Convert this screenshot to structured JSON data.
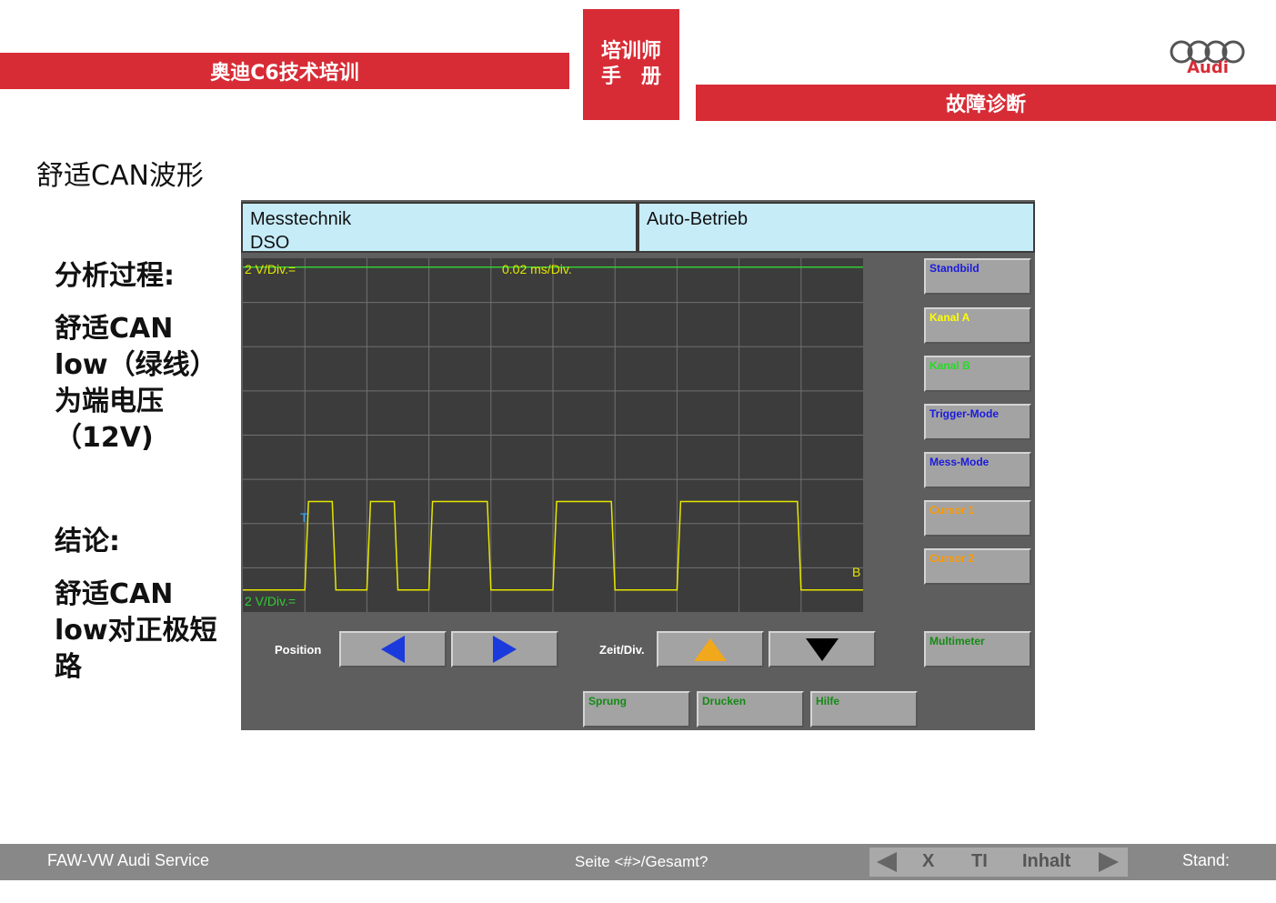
{
  "header": {
    "left_title": "奥迪C6技术培训",
    "center_line1": "培训师",
    "center_line2": "手　册",
    "right_title": "故障诊断",
    "logo_text": "Audi"
  },
  "slide_title": "舒适CAN波形",
  "sidebar_text": {
    "analysis_heading": "分析过程:",
    "analysis_body": "舒适CAN low（绿线）为端电压（12V)",
    "conclusion_heading": "结论:",
    "conclusion_body": "舒适CAN low对正极短路"
  },
  "tester": {
    "info_left_line1": "Messtechnik",
    "info_left_line2": "DSO",
    "info_right": "Auto-Betrieb",
    "scope": {
      "top_channel_label": "2 V/Div.=",
      "time_label": "0.02 ms/Div.",
      "bottom_channel_label": "2 V/Div.=",
      "trigger_marker": "T",
      "channel_a_marker": "B"
    },
    "side_buttons": [
      {
        "label": "Standbild",
        "color": "#1a1adc"
      },
      {
        "label": "Kanal A",
        "color": "#ffff00"
      },
      {
        "label": "Kanal B",
        "color": "#22dd22"
      },
      {
        "label": "Trigger-Mode",
        "color": "#1a1adc"
      },
      {
        "label": "Mess-Mode",
        "color": "#1a1adc"
      },
      {
        "label": "Cursor 1",
        "color": "#ff9900"
      },
      {
        "label": "Cursor 2",
        "color": "#ff9900"
      },
      {
        "label": "Multimeter",
        "color": "#148a14"
      }
    ],
    "position_label": "Position",
    "zeit_label": "Zeit/Div.",
    "bottom_buttons": [
      "Sprung",
      "Drucken",
      "Hilfe"
    ]
  },
  "chart_data": {
    "type": "line",
    "title": "",
    "xlabel": "0.02 ms/Div.",
    "ylabel": "2 V/Div.",
    "grid": true,
    "series": [
      {
        "name": "",
        "color": "#33cc33",
        "y_div": 7.8
      },
      {
        "name": "",
        "color": "#e6e600",
        "y_div": 0.5,
        "high_div": 2.5,
        "pulses_div": [
          [
            1.0,
            1.5
          ],
          [
            2.0,
            2.5
          ],
          [
            3.0,
            4.0
          ],
          [
            5.0,
            6.0
          ],
          [
            7.0,
            9.0
          ]
        ]
      }
    ]
  },
  "footer": {
    "left": "FAW-VW Audi Service",
    "middle": "Seite <#>/Gesamt?",
    "nav_x": "X",
    "nav_t": "TI",
    "nav_inhalt": "Inhalt",
    "stand": "Stand:"
  }
}
